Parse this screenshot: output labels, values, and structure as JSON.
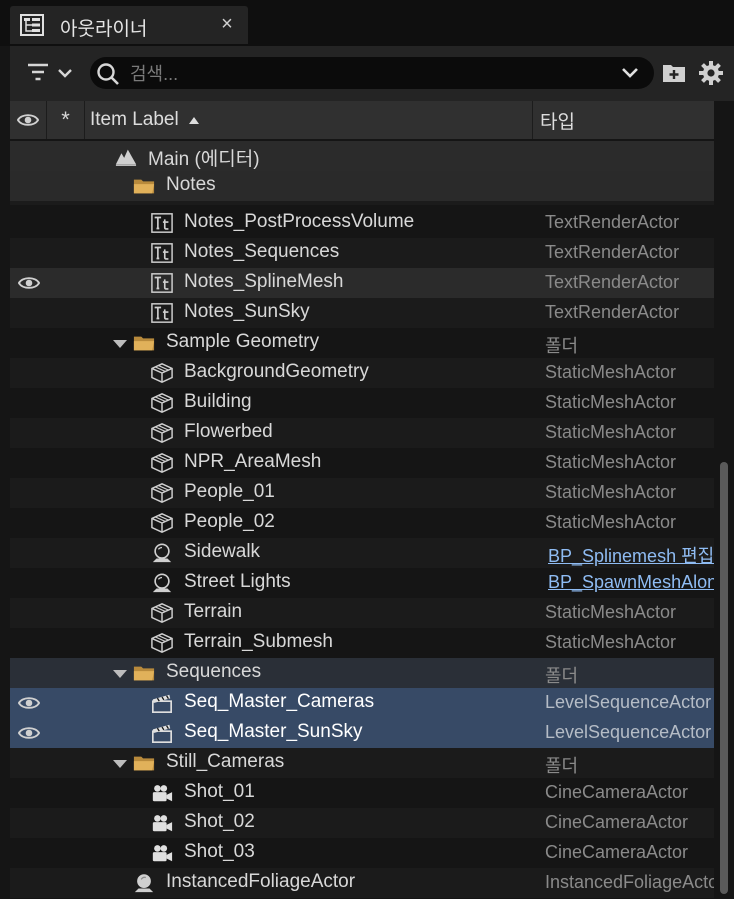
{
  "tab": {
    "title": "아웃라이너",
    "close": "×"
  },
  "search": {
    "placeholder": "검색..."
  },
  "header": {
    "label": "Item Label",
    "type": "타입"
  },
  "rows": [
    {
      "label": "Main (에디터)",
      "type": "",
      "icon": "level-icon"
    },
    {
      "label": "Notes",
      "type": "",
      "icon": "folder-icon"
    },
    {
      "label": "Notes_PostProcessVolume",
      "type": "TextRenderActor",
      "icon": "text-render-icon"
    },
    {
      "label": "Notes_Sequences",
      "type": "TextRenderActor",
      "icon": "text-render-icon"
    },
    {
      "label": "Notes_SplineMesh",
      "type": "TextRenderActor",
      "icon": "text-render-icon"
    },
    {
      "label": "Notes_SunSky",
      "type": "TextRenderActor",
      "icon": "text-render-icon"
    },
    {
      "label": "Sample Geometry",
      "type": "폴더",
      "icon": "folder-icon"
    },
    {
      "label": "BackgroundGeometry",
      "type": "StaticMeshActor",
      "icon": "static-mesh-icon"
    },
    {
      "label": "Building",
      "type": "StaticMeshActor",
      "icon": "static-mesh-icon"
    },
    {
      "label": "Flowerbed",
      "type": "StaticMeshActor",
      "icon": "static-mesh-icon"
    },
    {
      "label": "NPR_AreaMesh",
      "type": "StaticMeshActor",
      "icon": "static-mesh-icon"
    },
    {
      "label": "People_01",
      "type": "StaticMeshActor",
      "icon": "static-mesh-icon"
    },
    {
      "label": "People_02",
      "type": "StaticMeshActor",
      "icon": "static-mesh-icon"
    },
    {
      "label": "Sidewalk",
      "type": "BP_Splinemesh 편집",
      "icon": "blueprint-actor-icon"
    },
    {
      "label": "Street Lights",
      "type": "BP_SpawnMeshAlongSpline",
      "icon": "blueprint-actor-icon"
    },
    {
      "label": "Terrain",
      "type": "StaticMeshActor",
      "icon": "static-mesh-icon"
    },
    {
      "label": "Terrain_Submesh",
      "type": "StaticMeshActor",
      "icon": "static-mesh-icon"
    },
    {
      "label": "Sequences",
      "type": "폴더",
      "icon": "folder-icon"
    },
    {
      "label": "Seq_Master_Cameras",
      "type": "LevelSequenceActor",
      "icon": "clapper-icon"
    },
    {
      "label": "Seq_Master_SunSky",
      "type": "LevelSequenceActor",
      "icon": "clapper-icon"
    },
    {
      "label": "Still_Cameras",
      "type": "폴더",
      "icon": "folder-icon"
    },
    {
      "label": "Shot_01",
      "type": "CineCameraActor",
      "icon": "camera-icon"
    },
    {
      "label": "Shot_02",
      "type": "CineCameraActor",
      "icon": "camera-icon"
    },
    {
      "label": "Shot_03",
      "type": "CineCameraActor",
      "icon": "camera-icon"
    },
    {
      "label": "InstancedFoliageActor",
      "type": "InstancedFoliageActor",
      "icon": "foliage-actor-icon"
    }
  ]
}
